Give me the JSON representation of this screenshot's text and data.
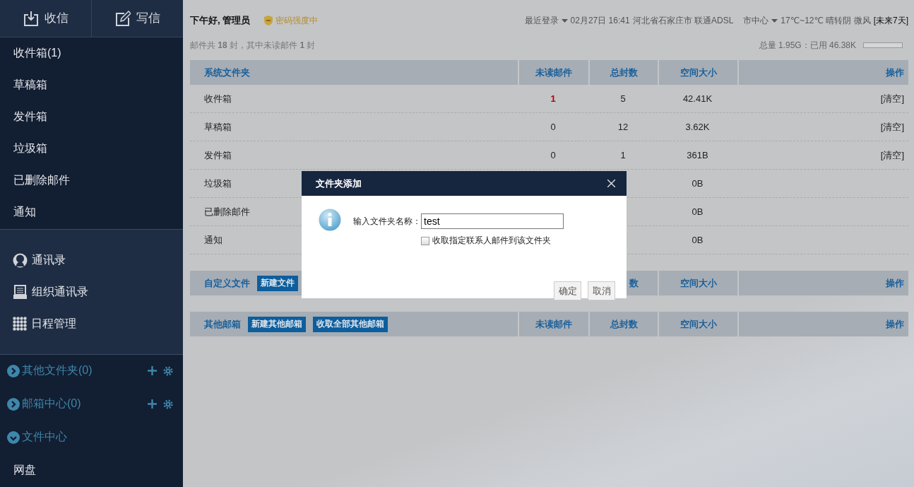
{
  "sidebar": {
    "actions": [
      {
        "kind": "receive",
        "label": "收信"
      },
      {
        "kind": "compose",
        "label": "写信"
      }
    ],
    "folders": [
      {
        "label": "收件箱(1)"
      },
      {
        "label": "草稿箱"
      },
      {
        "label": "发件箱"
      },
      {
        "label": "垃圾箱"
      },
      {
        "label": "已删除邮件"
      },
      {
        "label": "通知"
      }
    ],
    "tools": [
      {
        "kind": "contacts",
        "label": "通讯录"
      },
      {
        "kind": "org",
        "label": "组织通讯录"
      },
      {
        "kind": "calendar",
        "label": "日程管理"
      }
    ],
    "groups": [
      {
        "label": "其他文件夹(0)",
        "expanded": false,
        "addable": true
      },
      {
        "label": "邮箱中心(0)",
        "expanded": false,
        "addable": true
      },
      {
        "label": "文件中心",
        "expanded": true,
        "addable": false,
        "children": [
          {
            "label": "网盘"
          }
        ]
      }
    ]
  },
  "header": {
    "greeting": "下午好, 管理员",
    "password_strength": "密码强度中",
    "last_login": {
      "label": "最近登录",
      "time": "02月27日 16:41",
      "location": "河北省石家庄市 联通ADSL"
    },
    "weather": {
      "city": "市中心",
      "forecast": "17℃~12℃ 晴转阴 微风",
      "link": "[未来7天]"
    },
    "summary": "邮件共 **18** 封，其中未读邮件 **1** 封",
    "storage": {
      "text": "总量 1.95G：已用 46.38K",
      "level": 0
    }
  },
  "system_folders": {
    "title": "系统文件夹",
    "columns": {
      "unread": "未读邮件",
      "total": "总封数",
      "size": "空间大小",
      "action": "操作"
    },
    "rows": [
      {
        "name": "收件箱",
        "unread": "1",
        "highlight": true,
        "total": "5",
        "size": "42.41K",
        "action": "[清空]"
      },
      {
        "name": "草稿箱",
        "unread": "0",
        "highlight": false,
        "total": "12",
        "size": "3.62K",
        "action": "[清空]"
      },
      {
        "name": "发件箱",
        "unread": "0",
        "highlight": false,
        "total": "1",
        "size": "361B",
        "action": "[清空]"
      },
      {
        "name": "垃圾箱",
        "size": "0B"
      },
      {
        "name": "已删除邮件",
        "size": "0B"
      },
      {
        "name": "通知",
        "size": "0B"
      }
    ]
  },
  "custom_folders": {
    "title": "自定义文件",
    "buttons": [
      "新建文件"
    ],
    "columns": {
      "total": "数",
      "size": "空间大小",
      "action": "操作"
    }
  },
  "other_mailboxes": {
    "title": "其他邮箱",
    "buttons": [
      "新建其他邮箱",
      "收取全部其他邮箱"
    ],
    "columns": {
      "unread": "未读邮件",
      "total": "总封数",
      "size": "空间大小",
      "action": "操作"
    }
  },
  "dialog": {
    "title": "文件夹添加",
    "field_label": "输入文件夹名称：",
    "value": "test",
    "checkbox": {
      "label": "收取指定联系人邮件到该文件夹",
      "checked": false
    },
    "buttons": [
      "确定",
      "取消"
    ]
  }
}
